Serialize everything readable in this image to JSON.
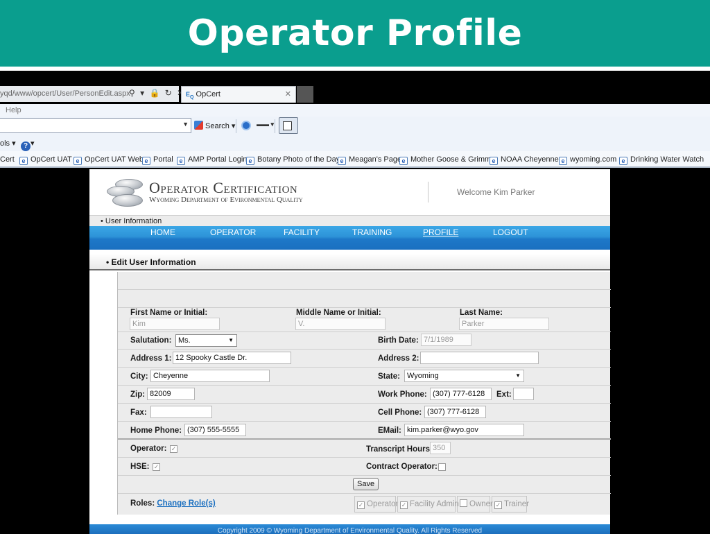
{
  "slide": {
    "title": "Operator Profile"
  },
  "browser": {
    "address": "yqd/www/opcert/User/PersonEdit.aspx",
    "address_icons": "⚲ ▾ 🔒 ↻ ✕",
    "tab_title": "OpCert",
    "menu_help": "Help",
    "toolbar_search": "Search",
    "tools_label": "ols",
    "favorites": [
      "Cert",
      "OpCert UAT",
      "OpCert UAT Web",
      "Portal",
      "AMP Portal Login",
      "Botany Photo of the Day",
      "Meagan's Page",
      "Mother Goose & Grimm",
      "NOAA Cheyenne",
      "wyoming.com",
      "Drinking Water Watch"
    ]
  },
  "header": {
    "title": "Operator Certification",
    "subtitle": "Wyoming Department of Evironmental Quality",
    "welcome": "Welcome Kim Parker"
  },
  "breadcrumb": "• User Information",
  "nav": [
    "HOME",
    "OPERATOR",
    "FACILITY",
    "TRAINING",
    "PROFILE",
    "LOGOUT"
  ],
  "nav_active": "PROFILE",
  "section_title": "• Edit User Information",
  "form": {
    "first_name_label": "First Name or Initial:",
    "first_name": "Kim",
    "middle_name_label": "Middle Name or Initial:",
    "middle_name": "V.",
    "last_name_label": "Last Name:",
    "last_name": "Parker",
    "salutation_label": "Salutation:",
    "salutation": "Ms.",
    "birth_date_label": "Birth Date:",
    "birth_date": "7/1/1989",
    "address1_label": "Address 1:",
    "address1": "12 Spooky Castle Dr.",
    "address2_label": "Address 2:",
    "address2": "",
    "city_label": "City:",
    "city": "Cheyenne",
    "state_label": "State:",
    "state": "Wyoming",
    "zip_label": "Zip:",
    "zip": "82009",
    "work_phone_label": "Work Phone:",
    "work_phone": "(307) 777-6128",
    "ext_label": "Ext:",
    "ext": "",
    "fax_label": "Fax:",
    "fax": "",
    "cell_phone_label": "Cell Phone:",
    "cell_phone": "(307) 777-6128",
    "home_phone_label": "Home Phone:",
    "home_phone": "(307) 555-5555",
    "email_label": "EMail:",
    "email": "kim.parker@wyo.gov",
    "operator_label": "Operator:",
    "operator_checked": true,
    "transcript_hours_label": "Transcript Hours:",
    "transcript_hours": "350",
    "hse_label": "HSE:",
    "hse_checked": true,
    "contract_operator_label": "Contract Operator:",
    "contract_operator_checked": false,
    "save_label": "Save",
    "roles_label": "Roles:",
    "change_roles_label": "Change Role(s)",
    "roles": [
      {
        "label": "Operator",
        "checked": true
      },
      {
        "label": "Facility Admin",
        "checked": true
      },
      {
        "label": "Owner",
        "checked": false
      },
      {
        "label": "Trainer",
        "checked": true
      }
    ]
  },
  "footer": "Copyright 2009 © Wyoming Department of Environmental Quality. All Rights Reserved"
}
